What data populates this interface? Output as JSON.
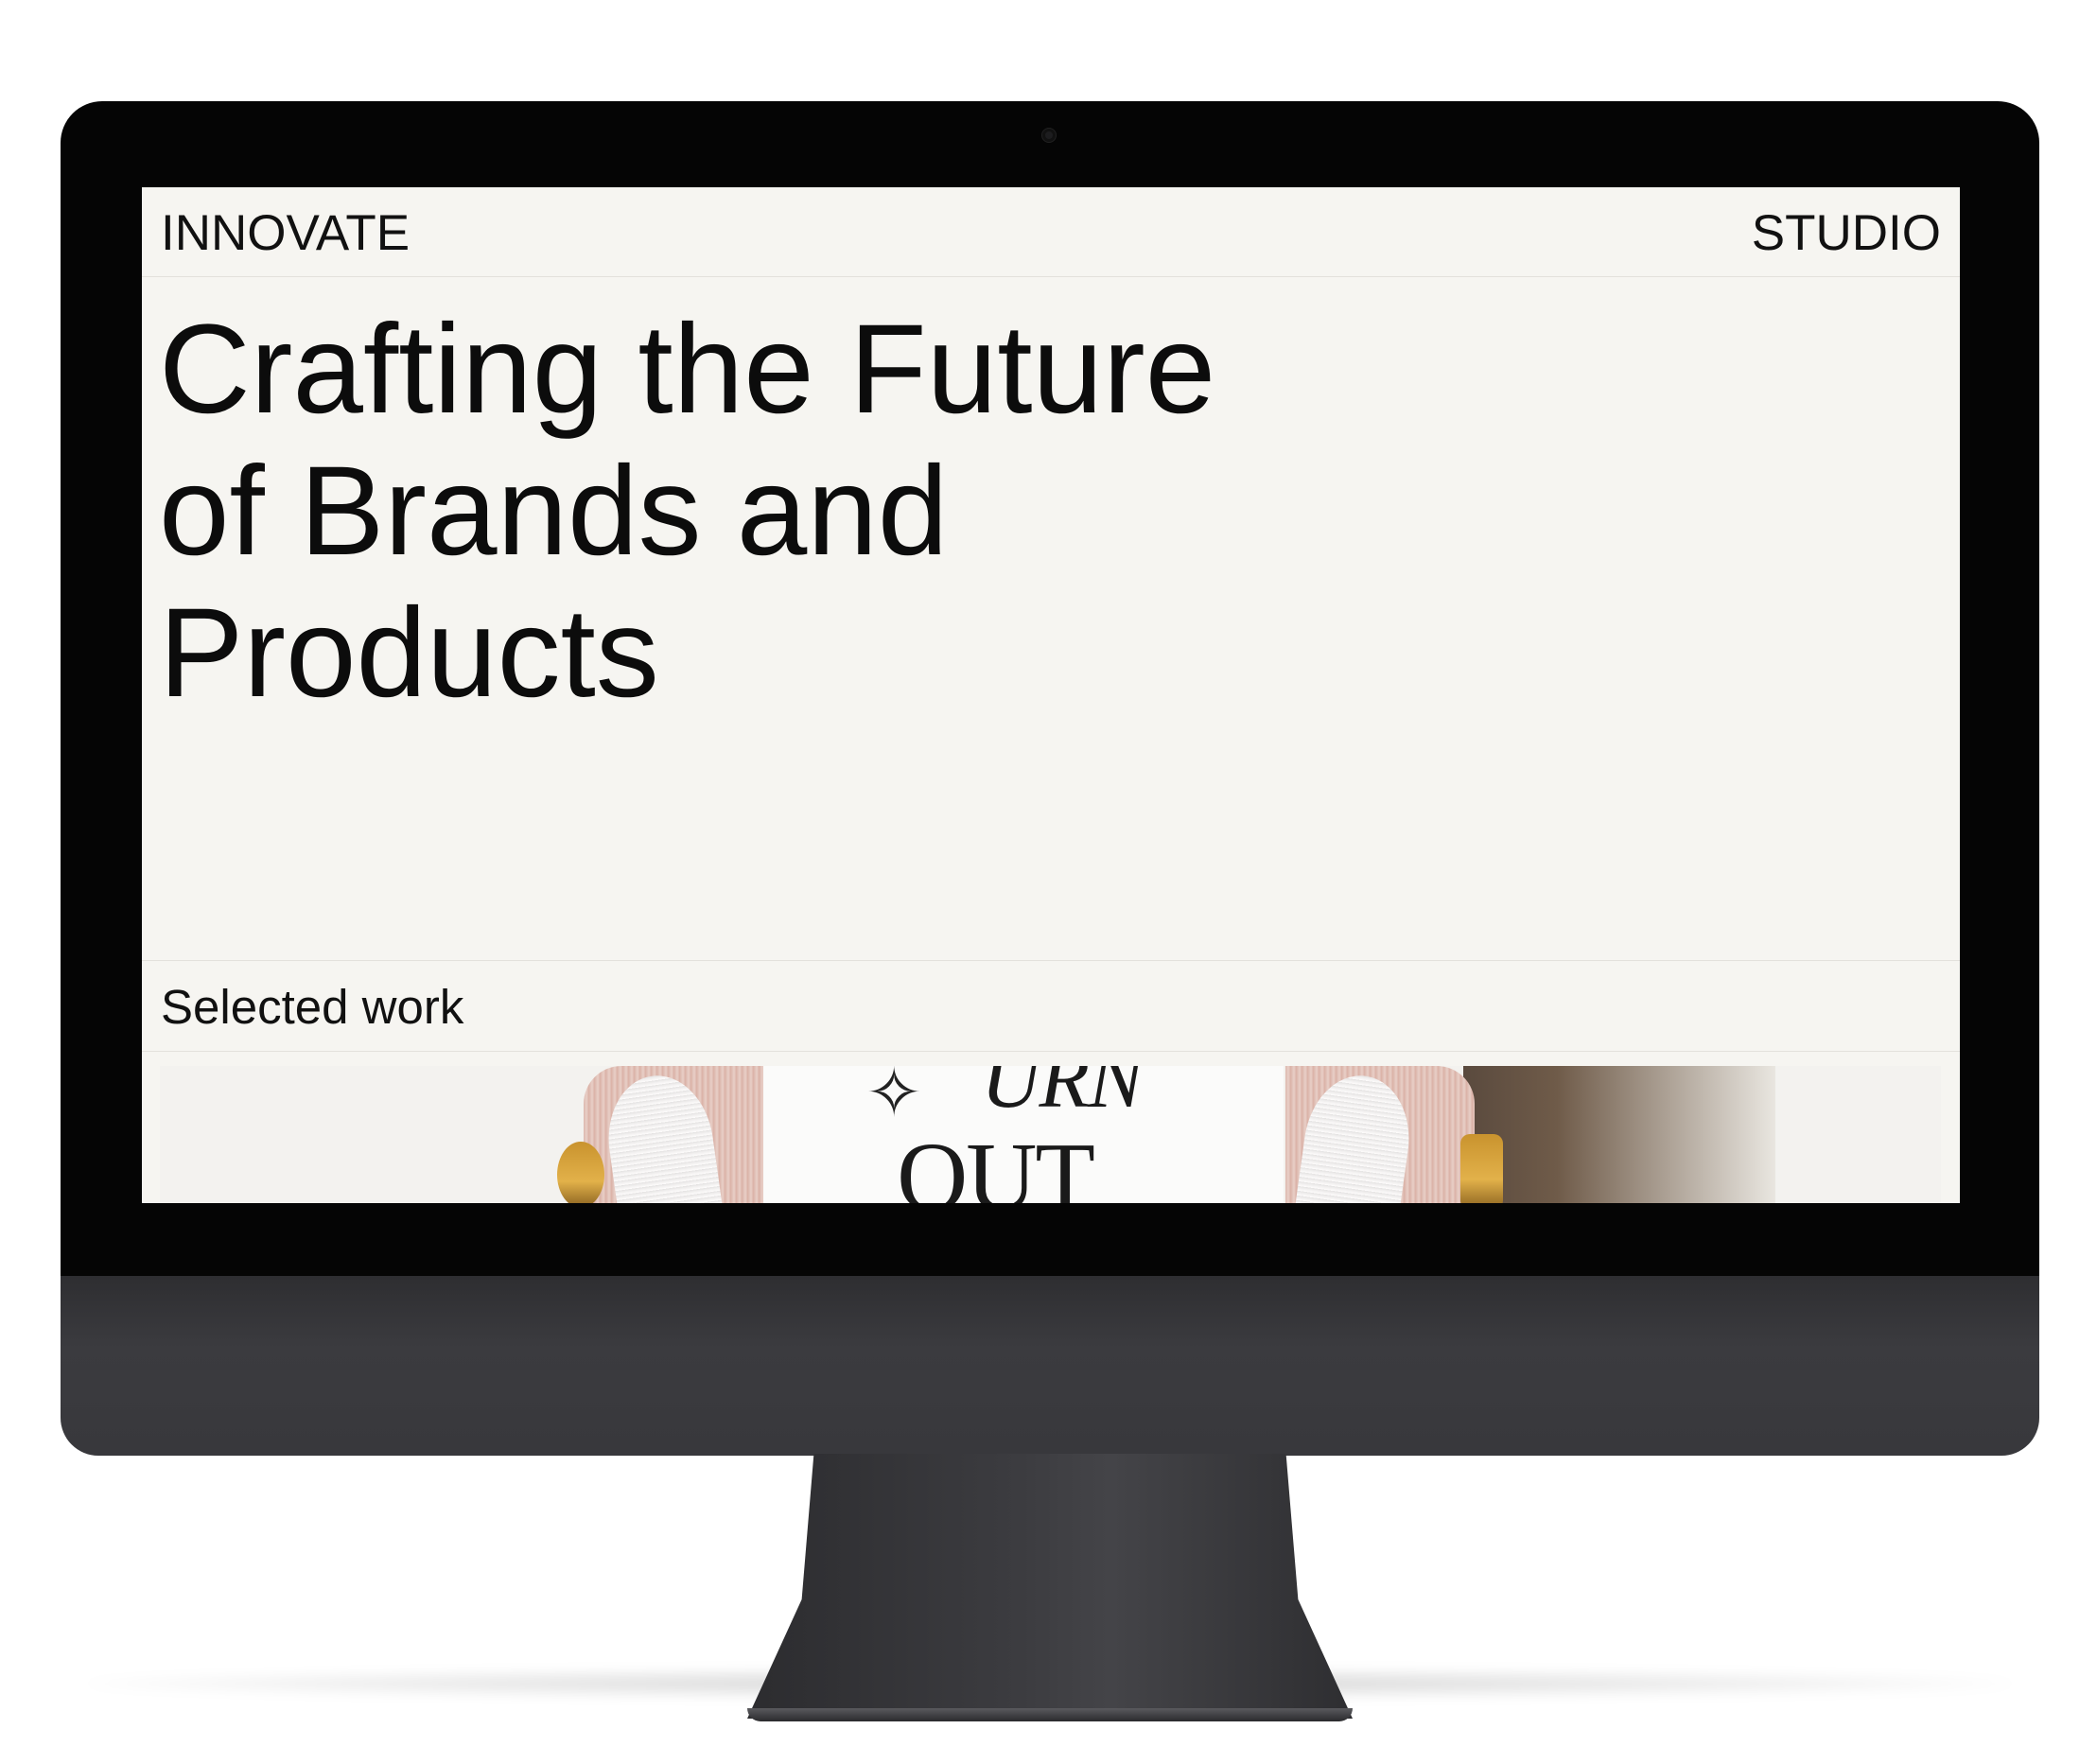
{
  "site": {
    "brand_left": "INNOVATE",
    "brand_right": "STUDIO"
  },
  "hero": {
    "title_line_1": "Crafting the Future",
    "title_line_2": "of Brands and",
    "title_line_3": "Products"
  },
  "work": {
    "section_title": "Selected work",
    "featured_image": {
      "text_top": "URN",
      "text_bottom": "OUT",
      "sparkle_icon": "sparkle-icon"
    }
  },
  "colors": {
    "page_background": "#f6f5f1",
    "text": "#111111",
    "divider": "#e3e1dc",
    "bezel": "#050505",
    "chin": "#38383c"
  }
}
